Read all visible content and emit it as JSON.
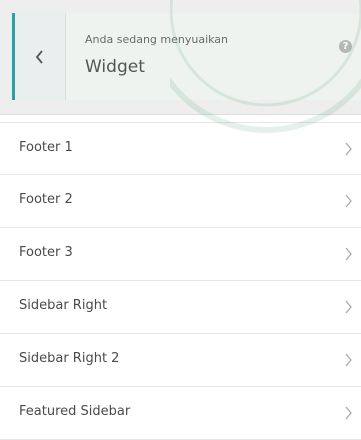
{
  "header": {
    "subtitle": "Anda sedang menyuaikan",
    "title": "Widget",
    "help_symbol": "?",
    "back_icon": "chevron-left-icon"
  },
  "sections": [
    {
      "label": "Footer 1"
    },
    {
      "label": "Footer 2"
    },
    {
      "label": "Footer 3"
    },
    {
      "label": "Sidebar Right"
    },
    {
      "label": "Sidebar Right 2"
    },
    {
      "label": "Featured Sidebar"
    }
  ],
  "colors": {
    "accent": "#2b9fa6",
    "header_bg": "#eeeeee",
    "title_bg": "#eef3ef"
  }
}
